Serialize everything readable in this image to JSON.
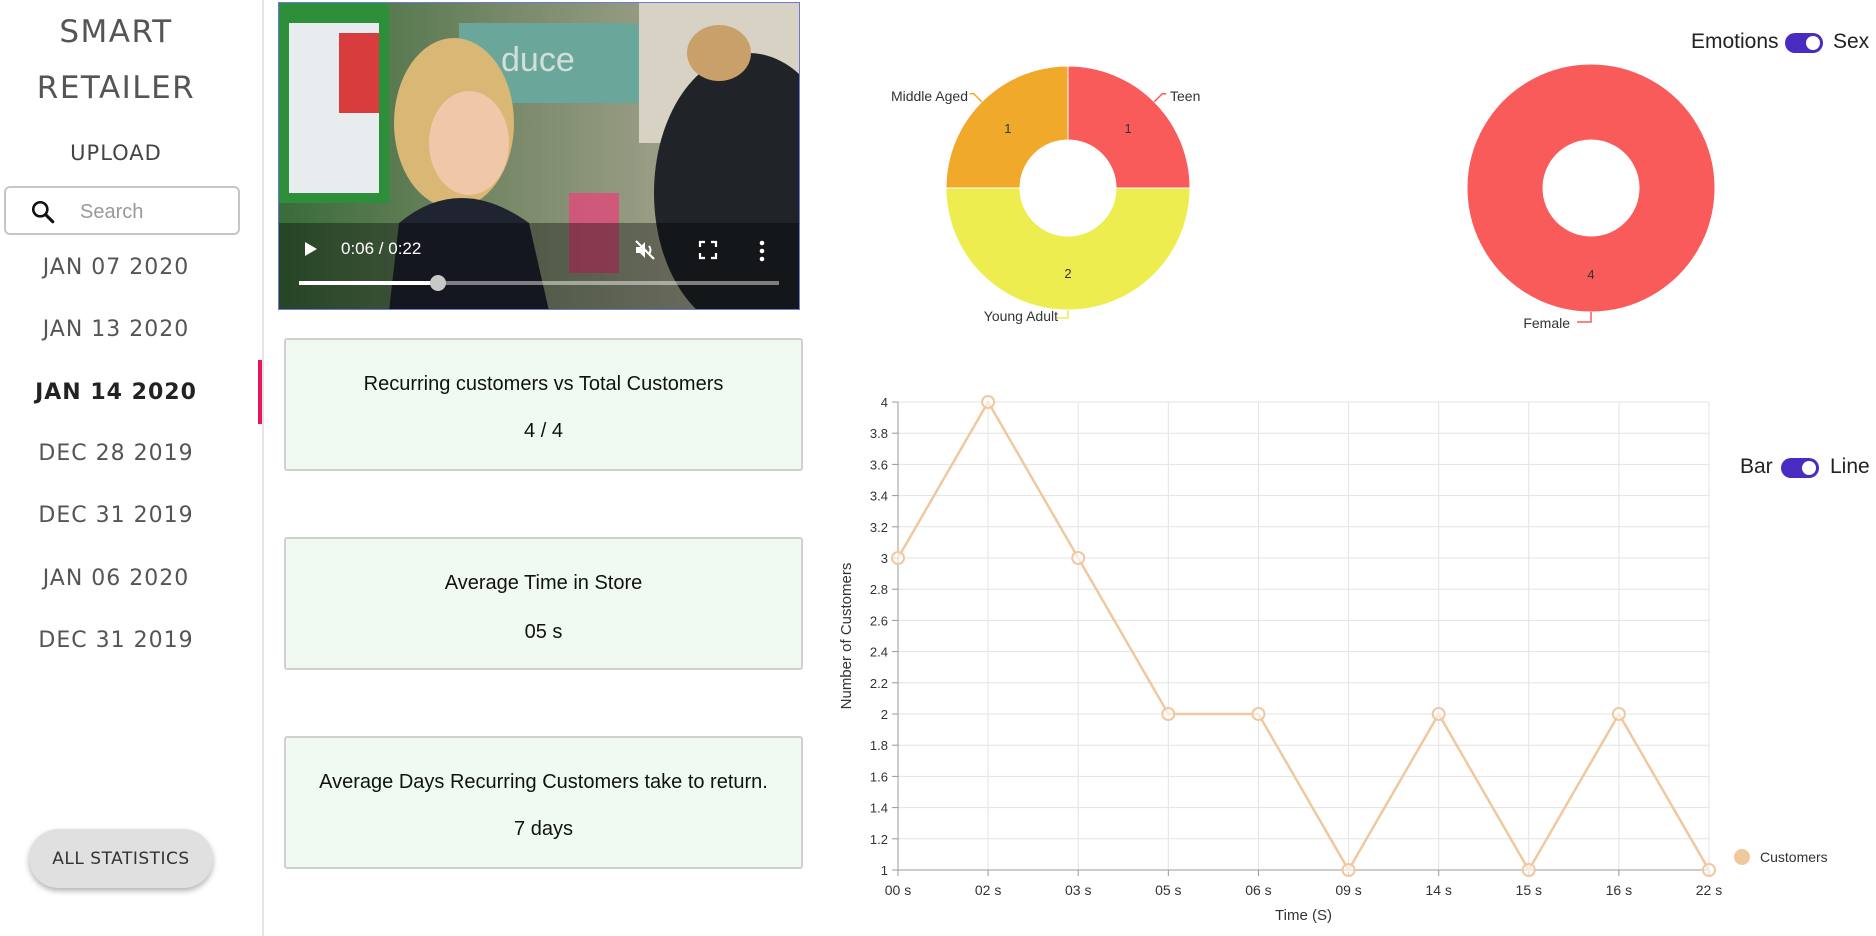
{
  "sidebar": {
    "brand_line1": "SMART",
    "brand_line2": "RETAILER",
    "upload_label": "UPLOAD",
    "search_placeholder": "Search",
    "dates": [
      "JAN 07 2020",
      "JAN 13 2020",
      "JAN 14 2020",
      "DEC 28 2019",
      "DEC 31 2019",
      "JAN 06 2020",
      "DEC 31 2019"
    ],
    "active_date": "JAN 14 2020",
    "all_stats_label": "ALL STATISTICS"
  },
  "video": {
    "time": "0:06 / 0:22",
    "progress": 0.29,
    "muted": true,
    "icons": [
      "play-icon",
      "mute-icon",
      "fullscreen-icon",
      "more-vert-icon"
    ]
  },
  "cards": [
    {
      "title": "Recurring customers vs Total Customers",
      "value": "4 / 4"
    },
    {
      "title": "Average Time in Store",
      "value": "05 s"
    },
    {
      "title": "Average Days Recurring Customers take to return.",
      "value": "7 days"
    }
  ],
  "toggles": {
    "emotions_sex": {
      "left": "Emotions",
      "right": "Sex",
      "state": "right"
    },
    "bar_line": {
      "left": "Bar",
      "right": "Line",
      "state": "right"
    }
  },
  "colors": {
    "accent": "#4a2bc2",
    "active_marker": "#e8175d",
    "card_bg": "#f0faf0",
    "line": "#f0c8a0"
  },
  "chart_data": [
    {
      "type": "pie",
      "subtype": "doughnut",
      "categories": [
        "Teen",
        "Young Adult",
        "Middle Aged"
      ],
      "values": [
        1,
        2,
        1
      ],
      "colors": [
        "#f95b5b",
        "#eeed4f",
        "#f0a92b"
      ]
    },
    {
      "type": "pie",
      "subtype": "doughnut",
      "categories": [
        "Female"
      ],
      "values": [
        4
      ],
      "colors": [
        "#f95b5b"
      ]
    },
    {
      "type": "line",
      "x": [
        "00 s",
        "02 s",
        "03 s",
        "05 s",
        "06 s",
        "09 s",
        "14 s",
        "15 s",
        "16 s",
        "22 s"
      ],
      "series": [
        {
          "name": "Customers",
          "values": [
            3,
            4,
            3,
            2,
            2,
            1,
            2,
            1,
            2,
            1
          ]
        }
      ],
      "xlabel": "Time (S)",
      "ylabel": "Number of Customers",
      "ylim": [
        1,
        4
      ],
      "yticks": [
        "1",
        "1.2",
        "1.4",
        "1.6",
        "1.8",
        "2",
        "2.2",
        "2.4",
        "2.6",
        "2.8",
        "3",
        "3.2",
        "3.4",
        "3.6",
        "3.8",
        "4"
      ],
      "grid": true,
      "legend": "right"
    }
  ]
}
